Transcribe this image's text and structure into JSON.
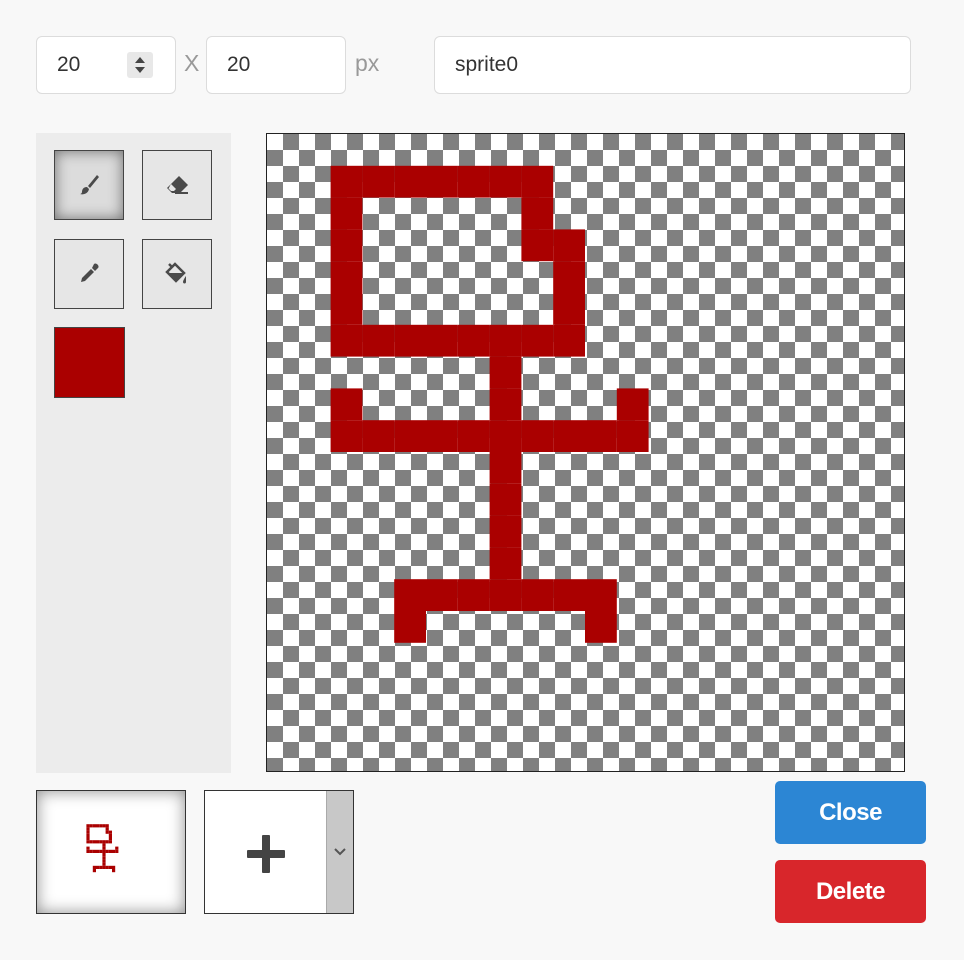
{
  "size": {
    "width_value": "20",
    "height_value": "20",
    "separator": "X",
    "unit": "px"
  },
  "sprite_name": "sprite0",
  "tools": [
    {
      "name": "brush",
      "icon": "brush-icon",
      "active": true
    },
    {
      "name": "eraser",
      "icon": "eraser-icon",
      "active": false
    },
    {
      "name": "eyedropper",
      "icon": "eyedropper-icon",
      "active": false
    },
    {
      "name": "fill",
      "icon": "fill-bucket-icon",
      "active": false
    }
  ],
  "current_color": "#aa0000",
  "grid": {
    "cols": 20,
    "rows": 20
  },
  "pixels": [
    [
      2,
      1
    ],
    [
      3,
      1
    ],
    [
      4,
      1
    ],
    [
      5,
      1
    ],
    [
      6,
      1
    ],
    [
      7,
      1
    ],
    [
      8,
      1
    ],
    [
      2,
      2
    ],
    [
      8,
      2
    ],
    [
      2,
      3
    ],
    [
      8,
      3
    ],
    [
      9,
      3
    ],
    [
      2,
      4
    ],
    [
      9,
      4
    ],
    [
      2,
      5
    ],
    [
      9,
      5
    ],
    [
      2,
      6
    ],
    [
      3,
      6
    ],
    [
      4,
      6
    ],
    [
      5,
      6
    ],
    [
      6,
      6
    ],
    [
      7,
      6
    ],
    [
      8,
      6
    ],
    [
      9,
      6
    ],
    [
      7,
      7
    ],
    [
      2,
      8
    ],
    [
      7,
      8
    ],
    [
      11,
      8
    ],
    [
      2,
      9
    ],
    [
      3,
      9
    ],
    [
      4,
      9
    ],
    [
      5,
      9
    ],
    [
      6,
      9
    ],
    [
      7,
      9
    ],
    [
      8,
      9
    ],
    [
      9,
      9
    ],
    [
      10,
      9
    ],
    [
      11,
      9
    ],
    [
      7,
      10
    ],
    [
      7,
      11
    ],
    [
      7,
      12
    ],
    [
      7,
      13
    ],
    [
      4,
      14
    ],
    [
      5,
      14
    ],
    [
      6,
      14
    ],
    [
      7,
      14
    ],
    [
      8,
      14
    ],
    [
      9,
      14
    ],
    [
      10,
      14
    ],
    [
      4,
      15
    ],
    [
      10,
      15
    ]
  ],
  "frames": [
    {
      "label": "frame-1"
    }
  ],
  "add_frame_icon": "plus-icon",
  "frame_menu_icon": "chevron-down-icon",
  "buttons": {
    "close": "Close",
    "delete": "Delete"
  }
}
